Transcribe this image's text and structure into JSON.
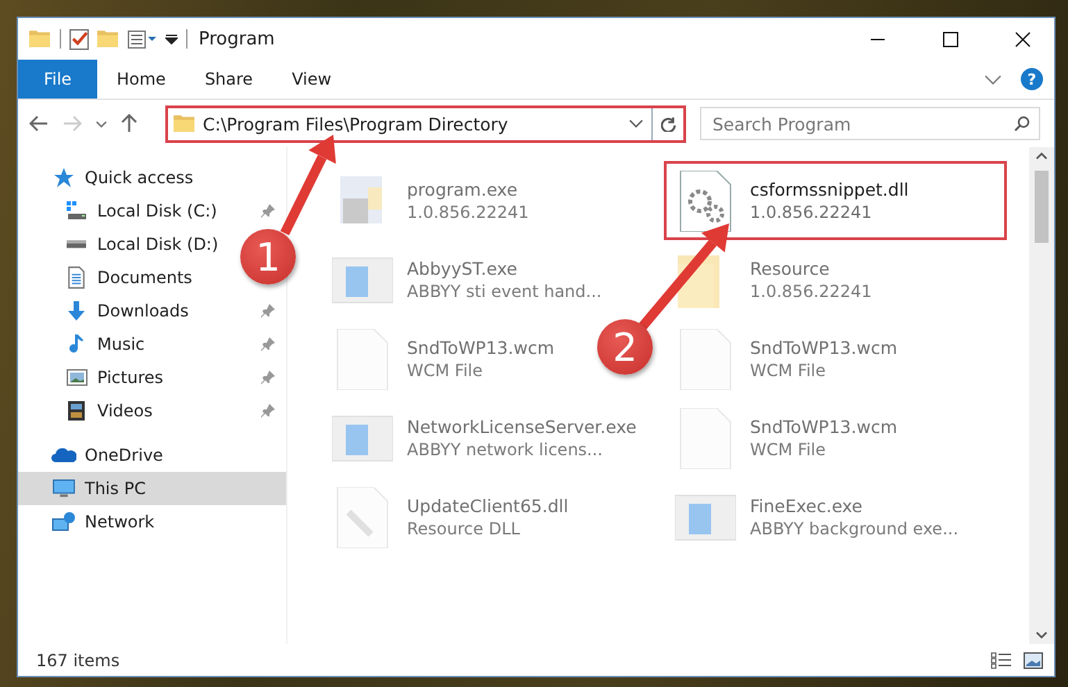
{
  "window": {
    "title": "Program"
  },
  "ribbon": {
    "tabs": [
      {
        "label": "File",
        "kind": "file"
      },
      {
        "label": "Home",
        "kind": "tab"
      },
      {
        "label": "Share",
        "kind": "tab"
      },
      {
        "label": "View",
        "kind": "tab"
      }
    ],
    "help": "?"
  },
  "address": {
    "path": "C:\\Program Files\\Program Directory",
    "outlined": true
  },
  "search": {
    "placeholder": "Search Program"
  },
  "sidebar": {
    "items": [
      {
        "label": "Quick access",
        "selected": false,
        "children": [
          {
            "label": "Local Disk (C:)",
            "pinned": true
          },
          {
            "label": "Local Disk (D:)",
            "pinned": false
          },
          {
            "label": "Documents",
            "pinned": false
          },
          {
            "label": "Downloads",
            "pinned": true
          },
          {
            "label": "Music",
            "pinned": true
          },
          {
            "label": "Pictures",
            "pinned": true
          },
          {
            "label": "Videos",
            "pinned": true
          }
        ]
      },
      {
        "label": "OneDrive",
        "selected": false
      },
      {
        "label": "This PC",
        "selected": true
      },
      {
        "label": "Network",
        "selected": false
      }
    ]
  },
  "files": [
    {
      "name": "program.exe",
      "detail": "1.0.856.22241",
      "blurred": true,
      "outlined": false
    },
    {
      "name": "csformssnippet.dll",
      "detail": "1.0.856.22241",
      "blurred": false,
      "outlined": true
    },
    {
      "name": "AbbyyST.exe",
      "detail": "ABBYY sti event hand...",
      "blurred": true,
      "outlined": false
    },
    {
      "name": "Resource",
      "detail": "1.0.856.22241",
      "blurred": true,
      "outlined": false
    },
    {
      "name": "SndToWP13.wcm",
      "detail": "WCM File",
      "blurred": true,
      "outlined": false
    },
    {
      "name": "SndToWP13.wcm",
      "detail": "WCM File",
      "blurred": true,
      "outlined": false
    },
    {
      "name": "NetworkLicenseServer.exe",
      "detail": "ABBYY network licens...",
      "blurred": true,
      "outlined": false
    },
    {
      "name": "SndToWP13.wcm",
      "detail": "WCM File",
      "blurred": true,
      "outlined": false
    },
    {
      "name": "UpdateClient65.dll",
      "detail": "Resource DLL",
      "blurred": true,
      "outlined": false
    },
    {
      "name": "FineExec.exe",
      "detail": "ABBYY background exe...",
      "blurred": true,
      "outlined": false
    }
  ],
  "status_bar": {
    "item_count": "167 items"
  },
  "annotations": [
    {
      "number": "1"
    },
    {
      "number": "2"
    }
  ]
}
